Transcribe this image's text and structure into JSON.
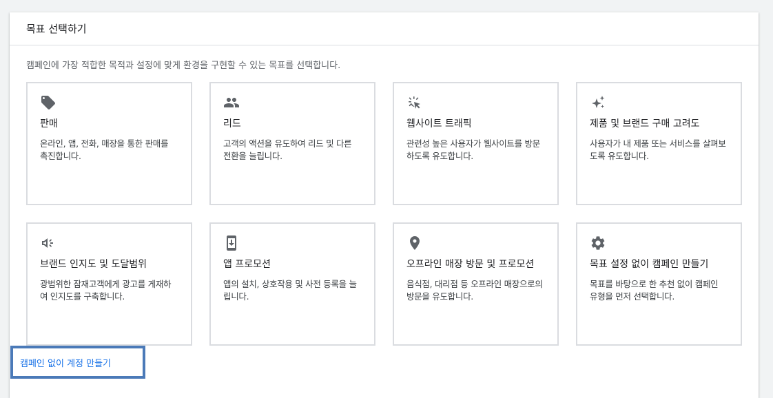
{
  "header": {
    "title": "목표 선택하기"
  },
  "subtitle": "캠페인에 가장 적합한 목적과 설정에 맞게 환경을 구현할 수 있는 목표를 선택합니다.",
  "goals": [
    {
      "icon": "tag-icon",
      "title": "판매",
      "desc": "온라인, 앱, 전화, 매장을 통한 판매를 촉진합니다."
    },
    {
      "icon": "people-icon",
      "title": "리드",
      "desc": "고객의 액션을 유도하여 리드 및 다른 전환을 늘립니다."
    },
    {
      "icon": "cursor-click-icon",
      "title": "웹사이트 트래픽",
      "desc": "관련성 높은 사용자가 웹사이트를 방문하도록 유도합니다."
    },
    {
      "icon": "sparkle-icon",
      "title": "제품 및 브랜드 구매 고려도",
      "desc": "사용자가 내 제품 또는 서비스를 살펴보도록 유도합니다."
    },
    {
      "icon": "megaphone-icon",
      "title": "브랜드 인지도 및 도달범위",
      "desc": "광범위한 잠재고객에게 광고를 게재하여 인지도를 구축합니다."
    },
    {
      "icon": "phone-download-icon",
      "title": "앱 프로모션",
      "desc": "앱의 설치, 상호작용 및 사전 등록을 늘립니다."
    },
    {
      "icon": "location-pin-icon",
      "title": "오프라인 매장 방문 및 프로모션",
      "desc": "음식점, 대리점 등 오프라인 매장으로의 방문을 유도합니다."
    },
    {
      "icon": "gear-icon",
      "title": "목표 설정 없이 캠페인 만들기",
      "desc": "목표를 바탕으로 한 추천 없이 캠페인 유형을 먼저 선택합니다."
    }
  ],
  "footer": {
    "link_label": "캠페인 없이 계정 만들기"
  }
}
